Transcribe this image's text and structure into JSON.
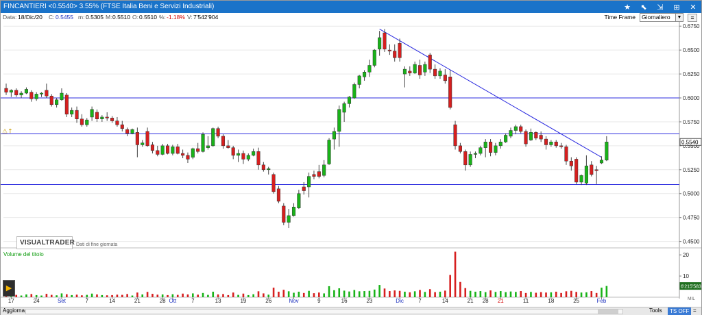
{
  "titlebar": {
    "title": "FINCANTIERI <0.5540> 3.55%  (FTSE Italia Beni e Servizi Industriali)",
    "icons": [
      "star-icon",
      "pin-icon",
      "collapse-icon",
      "grid-icon",
      "close-icon"
    ]
  },
  "infobar": {
    "date_label": "Data:",
    "date": "18/Dic/20",
    "close_label": "C:",
    "close": "0.5455",
    "min_label": "m:",
    "min": "0.5305",
    "max_label": "M:",
    "max": "0.5510",
    "open_label": "O:",
    "open": "0.5510",
    "pct_label": "%:",
    "pct": "-1.18%",
    "volume_label": "V:",
    "volume": "7'542'904",
    "timeframe_label": "Time Frame",
    "timeframe_value": "Giornaliero"
  },
  "logo": {
    "brand": "VISUALTRADER",
    "subtitle": "Dati di fine giornata"
  },
  "volume_panel": {
    "title": "Volume del titolo",
    "current_volume_label": "6'215'583",
    "scale_unit": "MIL"
  },
  "bottom": {
    "refresh": "Aggiorna",
    "tools": "Tools",
    "ts_off": "TS OFF",
    "eq": "="
  },
  "colors": {
    "titlebar": "#1a73c9",
    "up": "#19b319",
    "down": "#d61f1f",
    "line": "#2a2adf"
  },
  "chart_data": [
    {
      "type": "candlestick",
      "price_axis_ticks": [
        "0.6750",
        "0.6500",
        "0.6250",
        "0.6000",
        "0.5750",
        "0.5500",
        "0.5250",
        "0.5000",
        "0.4750",
        "0.4500"
      ],
      "ylim": [
        0.444,
        0.678
      ],
      "x_ticks": [
        {
          "i": 1,
          "label": "17"
        },
        {
          "i": 6,
          "label": "24"
        },
        {
          "i": 11,
          "label": "Set",
          "color": "#1b2fbd"
        },
        {
          "i": 16,
          "label": "7"
        },
        {
          "i": 21,
          "label": "14"
        },
        {
          "i": 26,
          "label": "21"
        },
        {
          "i": 31,
          "label": "28"
        },
        {
          "i": 33,
          "label": "Ott",
          "color": "#1b2fbd"
        },
        {
          "i": 37,
          "label": "7"
        },
        {
          "i": 42,
          "label": "13"
        },
        {
          "i": 47,
          "label": "19"
        },
        {
          "i": 52,
          "label": "26"
        },
        {
          "i": 57,
          "label": "Nov",
          "color": "#1b2fbd"
        },
        {
          "i": 62,
          "label": "9"
        },
        {
          "i": 67,
          "label": "16"
        },
        {
          "i": 72,
          "label": "23"
        },
        {
          "i": 78,
          "label": "Dic",
          "color": "#1b2fbd"
        },
        {
          "i": 82,
          "label": "7"
        },
        {
          "i": 87,
          "label": "14"
        },
        {
          "i": 92,
          "label": "21"
        },
        {
          "i": 95,
          "label": "28"
        },
        {
          "i": 98,
          "label": "21",
          "color": "#d40000"
        },
        {
          "i": 103,
          "label": "11"
        },
        {
          "i": 108,
          "label": "18"
        },
        {
          "i": 113,
          "label": "25"
        },
        {
          "i": 118,
          "label": "Feb",
          "color": "#1b2fbd"
        }
      ],
      "horizontal_lines": [
        0.6,
        0.5625,
        0.5095
      ],
      "last_price_label": "0.5540",
      "trendline": [
        {
          "i": 74,
          "price": 0.672
        },
        {
          "i": 118,
          "price": 0.538
        }
      ],
      "candles": [
        {
          "o": 0.61,
          "h": 0.615,
          "l": 0.603,
          "c": 0.606
        },
        {
          "o": 0.606,
          "h": 0.609,
          "l": 0.601,
          "c": 0.608
        },
        {
          "o": 0.608,
          "h": 0.61,
          "l": 0.601,
          "c": 0.603
        },
        {
          "o": 0.603,
          "h": 0.607,
          "l": 0.6,
          "c": 0.605
        },
        {
          "o": 0.605,
          "h": 0.611,
          "l": 0.604,
          "c": 0.609
        },
        {
          "o": 0.606,
          "h": 0.608,
          "l": 0.596,
          "c": 0.599
        },
        {
          "o": 0.599,
          "h": 0.606,
          "l": 0.597,
          "c": 0.604
        },
        {
          "o": 0.604,
          "h": 0.606,
          "l": 0.601,
          "c": 0.605
        },
        {
          "o": 0.608,
          "h": 0.615,
          "l": 0.6,
          "c": 0.602
        },
        {
          "o": 0.602,
          "h": 0.604,
          "l": 0.591,
          "c": 0.593
        },
        {
          "o": 0.593,
          "h": 0.6,
          "l": 0.59,
          "c": 0.598
        },
        {
          "o": 0.598,
          "h": 0.61,
          "l": 0.597,
          "c": 0.605
        },
        {
          "o": 0.603,
          "h": 0.605,
          "l": 0.58,
          "c": 0.583
        },
        {
          "o": 0.583,
          "h": 0.59,
          "l": 0.58,
          "c": 0.587
        },
        {
          "o": 0.587,
          "h": 0.591,
          "l": 0.574,
          "c": 0.578
        },
        {
          "o": 0.578,
          "h": 0.583,
          "l": 0.57,
          "c": 0.572
        },
        {
          "o": 0.572,
          "h": 0.579,
          "l": 0.57,
          "c": 0.577
        },
        {
          "o": 0.58,
          "h": 0.591,
          "l": 0.576,
          "c": 0.588
        },
        {
          "o": 0.585,
          "h": 0.588,
          "l": 0.575,
          "c": 0.578
        },
        {
          "o": 0.578,
          "h": 0.582,
          "l": 0.575,
          "c": 0.58
        },
        {
          "o": 0.58,
          "h": 0.585,
          "l": 0.576,
          "c": 0.579
        },
        {
          "o": 0.579,
          "h": 0.581,
          "l": 0.574,
          "c": 0.576
        },
        {
          "o": 0.576,
          "h": 0.58,
          "l": 0.57,
          "c": 0.572
        },
        {
          "o": 0.572,
          "h": 0.576,
          "l": 0.565,
          "c": 0.568
        },
        {
          "o": 0.567,
          "h": 0.569,
          "l": 0.56,
          "c": 0.563
        },
        {
          "o": 0.563,
          "h": 0.568,
          "l": 0.562,
          "c": 0.567
        },
        {
          "o": 0.564,
          "h": 0.569,
          "l": 0.538,
          "c": 0.551
        },
        {
          "o": 0.551,
          "h": 0.556,
          "l": 0.549,
          "c": 0.553
        },
        {
          "o": 0.565,
          "h": 0.569,
          "l": 0.549,
          "c": 0.55
        },
        {
          "o": 0.551,
          "h": 0.554,
          "l": 0.542,
          "c": 0.545
        },
        {
          "o": 0.545,
          "h": 0.55,
          "l": 0.539,
          "c": 0.541
        },
        {
          "o": 0.541,
          "h": 0.552,
          "l": 0.54,
          "c": 0.55
        },
        {
          "o": 0.55,
          "h": 0.552,
          "l": 0.541,
          "c": 0.542
        },
        {
          "o": 0.542,
          "h": 0.551,
          "l": 0.54,
          "c": 0.549
        },
        {
          "o": 0.549,
          "h": 0.552,
          "l": 0.541,
          "c": 0.542
        },
        {
          "o": 0.542,
          "h": 0.546,
          "l": 0.537,
          "c": 0.54
        },
        {
          "o": 0.54,
          "h": 0.543,
          "l": 0.532,
          "c": 0.536
        },
        {
          "o": 0.538,
          "h": 0.548,
          "l": 0.536,
          "c": 0.547
        },
        {
          "o": 0.547,
          "h": 0.553,
          "l": 0.542,
          "c": 0.544
        },
        {
          "o": 0.544,
          "h": 0.564,
          "l": 0.543,
          "c": 0.562
        },
        {
          "o": 0.548,
          "h": 0.56,
          "l": 0.546,
          "c": 0.55
        },
        {
          "o": 0.55,
          "h": 0.569,
          "l": 0.549,
          "c": 0.568
        },
        {
          "o": 0.568,
          "h": 0.57,
          "l": 0.558,
          "c": 0.56
        },
        {
          "o": 0.56,
          "h": 0.562,
          "l": 0.547,
          "c": 0.55
        },
        {
          "o": 0.55,
          "h": 0.556,
          "l": 0.547,
          "c": 0.548
        },
        {
          "o": 0.548,
          "h": 0.55,
          "l": 0.536,
          "c": 0.54
        },
        {
          "o": 0.54,
          "h": 0.546,
          "l": 0.533,
          "c": 0.542
        },
        {
          "o": 0.542,
          "h": 0.545,
          "l": 0.531,
          "c": 0.536
        },
        {
          "o": 0.536,
          "h": 0.542,
          "l": 0.534,
          "c": 0.54
        },
        {
          "o": 0.54,
          "h": 0.547,
          "l": 0.539,
          "c": 0.544
        },
        {
          "o": 0.544,
          "h": 0.548,
          "l": 0.525,
          "c": 0.53
        },
        {
          "o": 0.53,
          "h": 0.533,
          "l": 0.523,
          "c": 0.525
        },
        {
          "o": 0.525,
          "h": 0.528,
          "l": 0.52,
          "c": 0.526
        },
        {
          "o": 0.52,
          "h": 0.522,
          "l": 0.5,
          "c": 0.502
        },
        {
          "o": 0.505,
          "h": 0.508,
          "l": 0.49,
          "c": 0.492
        },
        {
          "o": 0.487,
          "h": 0.49,
          "l": 0.467,
          "c": 0.47
        },
        {
          "o": 0.47,
          "h": 0.484,
          "l": 0.464,
          "c": 0.477
        },
        {
          "o": 0.477,
          "h": 0.49,
          "l": 0.476,
          "c": 0.486
        },
        {
          "o": 0.485,
          "h": 0.504,
          "l": 0.484,
          "c": 0.5
        },
        {
          "o": 0.507,
          "h": 0.512,
          "l": 0.499,
          "c": 0.503
        },
        {
          "o": 0.507,
          "h": 0.522,
          "l": 0.496,
          "c": 0.518
        },
        {
          "o": 0.52,
          "h": 0.524,
          "l": 0.515,
          "c": 0.518
        },
        {
          "o": 0.523,
          "h": 0.53,
          "l": 0.516,
          "c": 0.518
        },
        {
          "o": 0.519,
          "h": 0.535,
          "l": 0.517,
          "c": 0.53
        },
        {
          "o": 0.531,
          "h": 0.558,
          "l": 0.53,
          "c": 0.556
        },
        {
          "o": 0.557,
          "h": 0.569,
          "l": 0.546,
          "c": 0.565
        },
        {
          "o": 0.565,
          "h": 0.592,
          "l": 0.549,
          "c": 0.588
        },
        {
          "o": 0.585,
          "h": 0.596,
          "l": 0.575,
          "c": 0.594
        },
        {
          "o": 0.594,
          "h": 0.602,
          "l": 0.59,
          "c": 0.601
        },
        {
          "o": 0.6,
          "h": 0.616,
          "l": 0.599,
          "c": 0.614
        },
        {
          "o": 0.614,
          "h": 0.624,
          "l": 0.61,
          "c": 0.623
        },
        {
          "o": 0.622,
          "h": 0.629,
          "l": 0.618,
          "c": 0.627
        },
        {
          "o": 0.627,
          "h": 0.64,
          "l": 0.622,
          "c": 0.634
        },
        {
          "o": 0.634,
          "h": 0.651,
          "l": 0.632,
          "c": 0.65
        },
        {
          "o": 0.651,
          "h": 0.67,
          "l": 0.644,
          "c": 0.663
        },
        {
          "o": 0.668,
          "h": 0.672,
          "l": 0.648,
          "c": 0.651
        },
        {
          "o": 0.65,
          "h": 0.656,
          "l": 0.645,
          "c": 0.649
        },
        {
          "o": 0.649,
          "h": 0.656,
          "l": 0.638,
          "c": 0.642
        },
        {
          "o": 0.657,
          "h": 0.662,
          "l": 0.638,
          "c": 0.642
        },
        {
          "o": 0.625,
          "h": 0.633,
          "l": 0.611,
          "c": 0.63
        },
        {
          "o": 0.628,
          "h": 0.633,
          "l": 0.623,
          "c": 0.626
        },
        {
          "o": 0.626,
          "h": 0.638,
          "l": 0.625,
          "c": 0.635
        },
        {
          "o": 0.634,
          "h": 0.64,
          "l": 0.62,
          "c": 0.624
        },
        {
          "o": 0.627,
          "h": 0.638,
          "l": 0.623,
          "c": 0.635
        },
        {
          "o": 0.645,
          "h": 0.647,
          "l": 0.626,
          "c": 0.63
        },
        {
          "o": 0.63,
          "h": 0.635,
          "l": 0.62,
          "c": 0.623
        },
        {
          "o": 0.623,
          "h": 0.631,
          "l": 0.62,
          "c": 0.628
        },
        {
          "o": 0.624,
          "h": 0.63,
          "l": 0.615,
          "c": 0.618
        },
        {
          "o": 0.622,
          "h": 0.629,
          "l": 0.588,
          "c": 0.59
        },
        {
          "o": 0.572,
          "h": 0.576,
          "l": 0.546,
          "c": 0.55
        },
        {
          "o": 0.55,
          "h": 0.553,
          "l": 0.542,
          "c": 0.544
        },
        {
          "o": 0.544,
          "h": 0.546,
          "l": 0.524,
          "c": 0.53
        },
        {
          "o": 0.53,
          "h": 0.544,
          "l": 0.528,
          "c": 0.541
        },
        {
          "o": 0.541,
          "h": 0.544,
          "l": 0.537,
          "c": 0.542
        },
        {
          "o": 0.542,
          "h": 0.55,
          "l": 0.54,
          "c": 0.548
        },
        {
          "o": 0.548,
          "h": 0.557,
          "l": 0.538,
          "c": 0.554
        },
        {
          "o": 0.554,
          "h": 0.557,
          "l": 0.539,
          "c": 0.543
        },
        {
          "o": 0.543,
          "h": 0.553,
          "l": 0.54,
          "c": 0.55
        },
        {
          "o": 0.55,
          "h": 0.557,
          "l": 0.547,
          "c": 0.554
        },
        {
          "o": 0.554,
          "h": 0.563,
          "l": 0.553,
          "c": 0.561
        },
        {
          "o": 0.56,
          "h": 0.569,
          "l": 0.558,
          "c": 0.566
        },
        {
          "o": 0.566,
          "h": 0.572,
          "l": 0.562,
          "c": 0.57
        },
        {
          "o": 0.57,
          "h": 0.572,
          "l": 0.563,
          "c": 0.565
        },
        {
          "o": 0.565,
          "h": 0.567,
          "l": 0.549,
          "c": 0.552
        },
        {
          "o": 0.556,
          "h": 0.568,
          "l": 0.555,
          "c": 0.564
        },
        {
          "o": 0.564,
          "h": 0.565,
          "l": 0.556,
          "c": 0.558
        },
        {
          "o": 0.561,
          "h": 0.565,
          "l": 0.554,
          "c": 0.557
        },
        {
          "o": 0.557,
          "h": 0.56,
          "l": 0.546,
          "c": 0.551
        },
        {
          "o": 0.551,
          "h": 0.556,
          "l": 0.549,
          "c": 0.554
        },
        {
          "o": 0.554,
          "h": 0.556,
          "l": 0.548,
          "c": 0.55
        },
        {
          "o": 0.55,
          "h": 0.553,
          "l": 0.547,
          "c": 0.549
        },
        {
          "o": 0.549,
          "h": 0.551,
          "l": 0.53,
          "c": 0.534
        },
        {
          "o": 0.534,
          "h": 0.538,
          "l": 0.524,
          "c": 0.529
        },
        {
          "o": 0.536,
          "h": 0.538,
          "l": 0.51,
          "c": 0.512
        },
        {
          "o": 0.512,
          "h": 0.52,
          "l": 0.509,
          "c": 0.519
        },
        {
          "o": 0.511,
          "h": 0.54,
          "l": 0.509,
          "c": 0.529
        },
        {
          "o": 0.53,
          "h": 0.534,
          "l": 0.518,
          "c": 0.52
        },
        {
          "o": 0.525,
          "h": 0.529,
          "l": 0.51,
          "c": 0.524
        },
        {
          "o": 0.532,
          "h": 0.539,
          "l": 0.531,
          "c": 0.535
        },
        {
          "o": 0.535,
          "h": 0.56,
          "l": 0.534,
          "c": 0.554
        }
      ],
      "volume_axis_ticks": [
        "20",
        "10"
      ],
      "volume_max": 22,
      "volumes": [
        1.2,
        0.9,
        1.1,
        0.8,
        1.3,
        1.5,
        1.0,
        0.8,
        1.6,
        1.1,
        0.9,
        1.8,
        1.4,
        1.0,
        1.2,
        0.9,
        1.1,
        1.7,
        1.3,
        1.0,
        0.9,
        1.0,
        1.2,
        1.1,
        1.5,
        0.8,
        2.2,
        1.3,
        2.5,
        1.6,
        1.2,
        1.3,
        1.0,
        1.4,
        1.1,
        1.7,
        1.3,
        1.8,
        1.2,
        2.0,
        1.1,
        2.6,
        1.3,
        1.5,
        1.0,
        2.2,
        1.1,
        1.7,
        1.0,
        1.4,
        2.8,
        1.8,
        1.2,
        4.5,
        2.6,
        3.5,
        2.8,
        2.1,
        2.6,
        2.0,
        3.0,
        1.9,
        2.2,
        1.8,
        5.2,
        3.3,
        4.2,
        3.1,
        2.7,
        3.4,
        2.8,
        2.9,
        3.0,
        3.6,
        5.8,
        4.1,
        2.9,
        3.2,
        3.0,
        2.6,
        2.3,
        2.8,
        3.4,
        2.5,
        3.8,
        2.4,
        2.6,
        3.1,
        10.5,
        21.5,
        7.2,
        4.3,
        3.0,
        2.6,
        2.9,
        2.4,
        3.2,
        2.5,
        2.9,
        2.4,
        2.7,
        2.5,
        2.9,
        2.0,
        2.5,
        2.1,
        2.4,
        2.2,
        2.3,
        2.6,
        2.0,
        2.8,
        3.0,
        2.5,
        2.2,
        2.3,
        2.9,
        2.0,
        4.5,
        5.3
      ]
    }
  ]
}
